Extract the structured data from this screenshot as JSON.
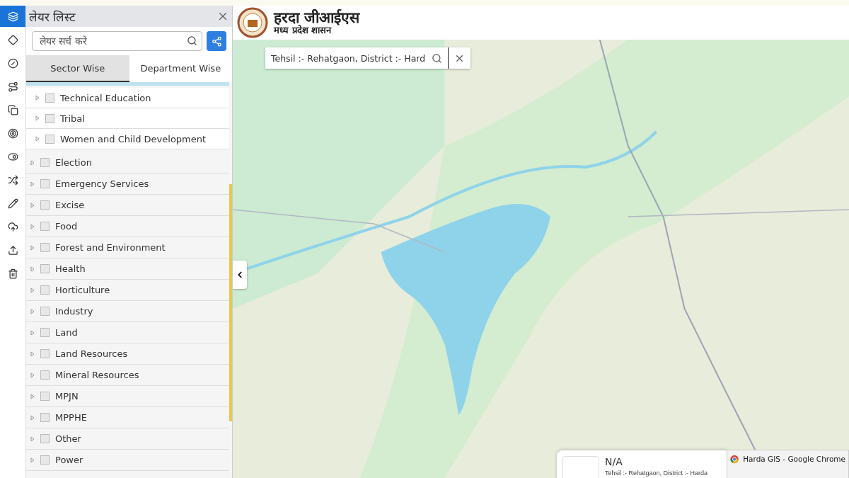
{
  "rail": [
    {
      "selected": true
    },
    {
      "selected": false
    },
    {
      "selected": false
    },
    {
      "selected": false
    },
    {
      "selected": false
    },
    {
      "selected": false
    },
    {
      "selected": false
    },
    {
      "selected": false
    },
    {
      "selected": false
    },
    {
      "selected": false
    },
    {
      "selected": false
    },
    {
      "selected": false
    }
  ],
  "panel": {
    "title": "लेयर लिस्ट",
    "search": {
      "placeholder": "लेयर सर्च करे"
    },
    "tabs": [
      {
        "label": "Sector Wise",
        "selected": true
      },
      {
        "label": "Department Wise",
        "selected": false
      }
    ],
    "tree": [
      {
        "children": [
          {
            "label": "Technical Education",
            "checked": false,
            "expanded": false
          },
          {
            "label": "Tribal",
            "checked": false,
            "expanded": false
          },
          {
            "label": "Women and Child Development",
            "checked": false,
            "expanded": false
          }
        ]
      },
      {
        "label": "Election",
        "checked": false,
        "expanded": false
      },
      {
        "label": "Emergency Services",
        "checked": false,
        "expanded": false
      },
      {
        "label": "Excise",
        "checked": false,
        "expanded": false
      },
      {
        "label": "Food",
        "checked": false,
        "expanded": false
      },
      {
        "label": "Forest and Environment",
        "checked": false,
        "expanded": false
      },
      {
        "label": "Health",
        "checked": false,
        "expanded": false
      },
      {
        "label": "Horticulture",
        "checked": false,
        "expanded": false
      },
      {
        "label": "Industry",
        "checked": false,
        "expanded": false
      },
      {
        "label": "Land",
        "checked": false,
        "expanded": false
      },
      {
        "label": "Land Resources",
        "checked": false,
        "expanded": false
      },
      {
        "label": "Mineral Resources",
        "checked": false,
        "expanded": false
      },
      {
        "label": "MPJN",
        "checked": false,
        "expanded": false
      },
      {
        "label": "MPPHE",
        "checked": false,
        "expanded": false
      },
      {
        "label": "Other",
        "checked": false,
        "expanded": false
      },
      {
        "label": "Power",
        "checked": false,
        "expanded": false
      }
    ]
  },
  "header": {
    "title": "हरदा जीआईएस",
    "subtitle": "मध्य प्रदेश शासन"
  },
  "map_search": {
    "value": "Tehsil :- Rehatgaon, District :- Hard"
  },
  "info_popup": {
    "title": "N/A",
    "text": "Tehsil :- Rehatgaon, District :- Harda"
  },
  "taskbar_preview": {
    "title": "Harda GIS - Google Chrome"
  }
}
